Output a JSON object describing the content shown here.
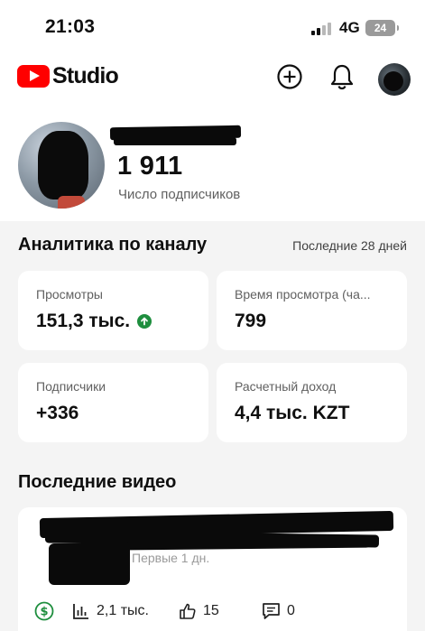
{
  "status_bar": {
    "time": "21:03",
    "network": "4G",
    "battery": "24"
  },
  "header": {
    "logo_text": "Studio",
    "icons": [
      "create-icon",
      "notifications-icon",
      "account-avatar"
    ]
  },
  "channel": {
    "subscribers_count": "1 911",
    "subscribers_label": "Число подписчиков"
  },
  "analytics": {
    "title": "Аналитика по каналу",
    "period": "Последние 28 дней",
    "cards": [
      {
        "label": "Просмотры",
        "value": "151,3 тыс.",
        "trend": "up"
      },
      {
        "label": "Время просмотра (ча...",
        "value": "799"
      },
      {
        "label": "Подписчики",
        "value": "+336"
      },
      {
        "label": "Расчетный доход",
        "value": "4,4 тыс. KZT"
      }
    ]
  },
  "recent_videos": {
    "title": "Последние видео",
    "items": [
      {
        "subtitle": "Первые 1 дн.",
        "views": "2,1 тыс.",
        "likes": "15",
        "comments": "0"
      }
    ]
  },
  "colors": {
    "brand_red": "#ff0000",
    "trend_green": "#1e8e3e",
    "monetization_green": "#1e8e3e"
  }
}
